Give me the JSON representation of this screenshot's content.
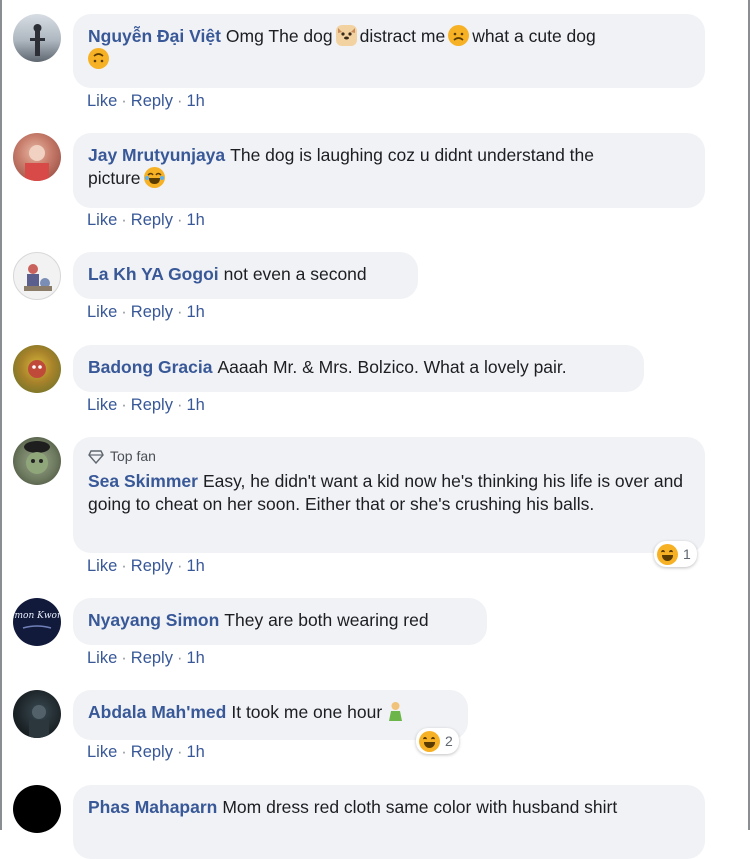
{
  "comments": [
    {
      "author": "Nguyễn Đại Việt",
      "text_1": "Omg The dog",
      "text_2": "distract me",
      "text_3": "what a cute dog",
      "actions": {
        "like": "Like",
        "reply": "Reply",
        "time": "1h"
      }
    },
    {
      "author": "Jay Mrutyunjaya",
      "text_1": "The dog is laughing coz u didnt understand the",
      "text_2": "picture",
      "actions": {
        "like": "Like",
        "reply": "Reply",
        "time": "1h"
      }
    },
    {
      "author": "La Kh YA Gogoi",
      "text": "not even a second",
      "actions": {
        "like": "Like",
        "reply": "Reply",
        "time": "1h"
      }
    },
    {
      "author": "Badong Gracia",
      "text": "Aaaah Mr. & Mrs. Bolzico. What a lovely pair.",
      "actions": {
        "like": "Like",
        "reply": "Reply",
        "time": "1h"
      }
    },
    {
      "badge": "Top fan",
      "author": "Sea Skimmer",
      "text": "Easy, he didn't want a kid now he's thinking his life is over and going to cheat on her soon. Either that or she's crushing his balls.",
      "reaction_count": "1",
      "actions": {
        "like": "Like",
        "reply": "Reply",
        "time": "1h"
      }
    },
    {
      "author": "Nyayang Simon",
      "text": "They are both wearing red",
      "actions": {
        "like": "Like",
        "reply": "Reply",
        "time": "1h"
      }
    },
    {
      "author": "Abdala Mah'med",
      "text": "It took me one hour",
      "reaction_count": "2",
      "actions": {
        "like": "Like",
        "reply": "Reply",
        "time": "1h"
      }
    },
    {
      "author": "Phas Mahaparn",
      "text": "Mom dress red cloth same color with husband shirt"
    }
  ],
  "avatar_texts": {
    "nyayang": "Simon Kwong"
  },
  "colors": {
    "author": "#385898",
    "bubble": "#f0f2f5",
    "reaction": "#f7b125"
  }
}
